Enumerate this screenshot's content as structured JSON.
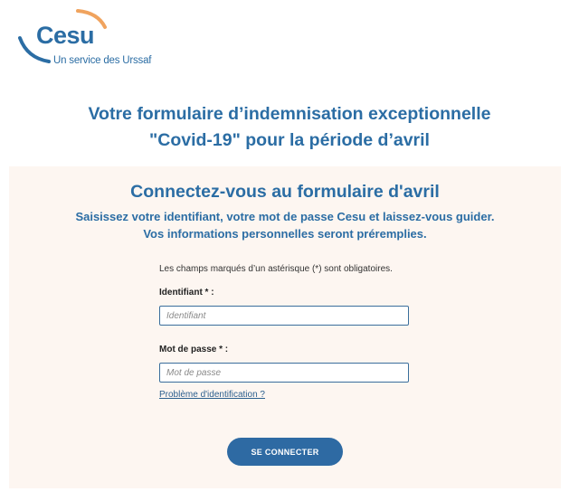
{
  "brand": {
    "name": "Cesu",
    "tagline": "Un service des Urssaf",
    "colors": {
      "primary": "#2b6da4",
      "accent_orange": "#f0a35e",
      "panel_background": "#fdf6f1",
      "button": "#2e6aa3"
    }
  },
  "header": {
    "title_line1": "Votre formulaire d’indemnisation exceptionnelle",
    "title_line2": "\"Covid-19\" pour la période d’avril"
  },
  "login": {
    "title": "Connectez-vous au formulaire d'avril",
    "subtitle_line1": "Saisissez votre identifiant, votre mot de passe Cesu et laissez-vous guider.",
    "subtitle_line2": "Vos informations personnelles seront préremplies.",
    "required_note": "Les champs marqués d’un astérisque (*) sont obligatoires.",
    "fields": {
      "identifiant": {
        "label": "Identifiant * :",
        "placeholder": "Identifiant",
        "value": ""
      },
      "password": {
        "label": "Mot de passe * :",
        "placeholder": "Mot de passe",
        "value": ""
      }
    },
    "help_link": "Problème d'identification ?",
    "submit_label": "SE CONNECTER"
  }
}
